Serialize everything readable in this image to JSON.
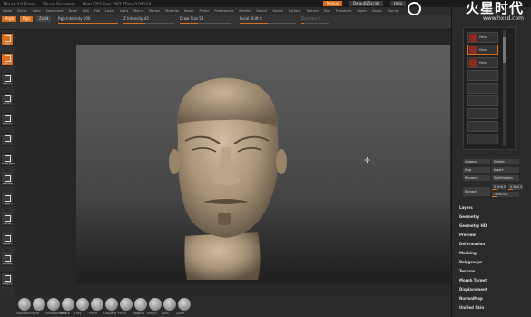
{
  "titlebar": {
    "items": [
      "ZBrush 4.0 [Core]",
      "ZBrush Document",
      "Mem 1251 Free 1587 ZTime 0 000 EX"
    ],
    "buttons": [
      {
        "label": "Menus",
        "hot": true
      },
      {
        "label": "DefaultZScript",
        "hot": false
      },
      {
        "label": "Help",
        "hot": false
      }
    ]
  },
  "logo": {
    "main": "火星时代",
    "sub": "www.hxsd.com"
  },
  "menubar": {
    "items": [
      "Alpha",
      "Brush",
      "Color",
      "Document",
      "Draw",
      "Edit",
      "File",
      "Layer",
      "Light",
      "Macro",
      "Marker",
      "Material",
      "Movie",
      "Picker",
      "Preferences",
      "Render",
      "Stencil",
      "Stroke",
      "Surface",
      "Texture",
      "Tool",
      "Transform",
      "Zoom",
      "Zapps",
      "Zscript"
    ]
  },
  "toolbar": {
    "chips": [
      {
        "label": "Mrgb",
        "style": "orange"
      },
      {
        "label": "Rgb",
        "style": "orange"
      },
      {
        "label": "Zadd",
        "style": "gray"
      }
    ],
    "sliders": [
      {
        "label": "Rgb Intensity 100",
        "fill": 1.0
      },
      {
        "label": "Z Intensity 42",
        "fill": 0.42
      },
      {
        "label": "Draw Size 54",
        "fill": 0.35
      },
      {
        "label": "Focal Shift 0",
        "fill": 0.5
      },
      {
        "label": "Dynamic 0",
        "fill": 0.1
      }
    ]
  },
  "lefttools": {
    "items": [
      {
        "label": "Edit",
        "active": true
      },
      {
        "label": "Draw",
        "active": true
      },
      {
        "label": "Move",
        "active": false
      },
      {
        "label": "Scale",
        "active": false
      },
      {
        "label": "Rotate",
        "active": false
      },
      {
        "label": "",
        "active": false
      },
      {
        "label": "FreeHand",
        "active": false
      },
      {
        "label": "Texture",
        "active": false
      },
      {
        "label": "Spix",
        "active": false
      },
      {
        "label": "Scroll",
        "active": false
      },
      {
        "label": "Zoom",
        "active": false
      },
      {
        "label": "Actual",
        "active": false
      },
      {
        "label": "L.Sym",
        "active": false
      }
    ]
  },
  "bottombar": {
    "brushes": [
      "Standard",
      "Move",
      "SmoothPeaks",
      "Inflate",
      "Clay",
      "Pinch",
      "Displace",
      "Pinch",
      "Magnify",
      "Morph",
      "Blob",
      "Layer"
    ]
  },
  "rightpanel": {
    "subtools": [
      {
        "label": "Head",
        "selected": false
      },
      {
        "label": "Head",
        "selected": true
      },
      {
        "label": "Head",
        "selected": false
      },
      {
        "label": "",
        "selected": false
      },
      {
        "label": "",
        "selected": false
      },
      {
        "label": "",
        "selected": false
      },
      {
        "label": "",
        "selected": false
      },
      {
        "label": "",
        "selected": false
      },
      {
        "label": "",
        "selected": false
      }
    ],
    "buttons": [
      {
        "label": "Append"
      },
      {
        "label": "Delete"
      },
      {
        "label": "Dup"
      },
      {
        "label": "Insert"
      },
      {
        "label": "Rename"
      },
      {
        "label": "SplitHidden"
      }
    ],
    "extract_label": "Extract",
    "extract_sliders": [
      {
        "label": "S Smt 5",
        "fill": 0.3
      },
      {
        "label": "S Smt 5",
        "fill": 0.3
      },
      {
        "label": "Thick 0.1",
        "fill": 0.2
      }
    ],
    "sections": [
      "Layers",
      "Geometry",
      "Geometry HD",
      "Preview",
      "Deformation",
      "Masking",
      "Polygroups",
      "Texture",
      "Morph Target",
      "Displacement",
      "NormalMap",
      "Unified Skin"
    ]
  }
}
